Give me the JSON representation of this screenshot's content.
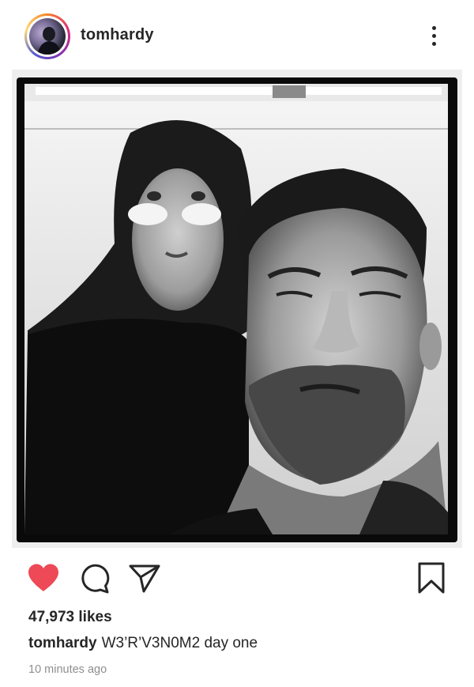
{
  "post": {
    "username": "tomhardy",
    "likes": "47,973 likes",
    "caption_user": "tomhardy",
    "caption_text": "W3’R’V3N0M2 day one",
    "timestamp": "10 minutes ago",
    "liked": true
  },
  "icons": {
    "more": "more-vertical-icon",
    "like": "heart-icon",
    "comment": "comment-icon",
    "share": "send-icon",
    "save": "bookmark-icon"
  },
  "colors": {
    "like": "#ed4956",
    "text": "#262626",
    "muted": "#8e8e8e"
  }
}
